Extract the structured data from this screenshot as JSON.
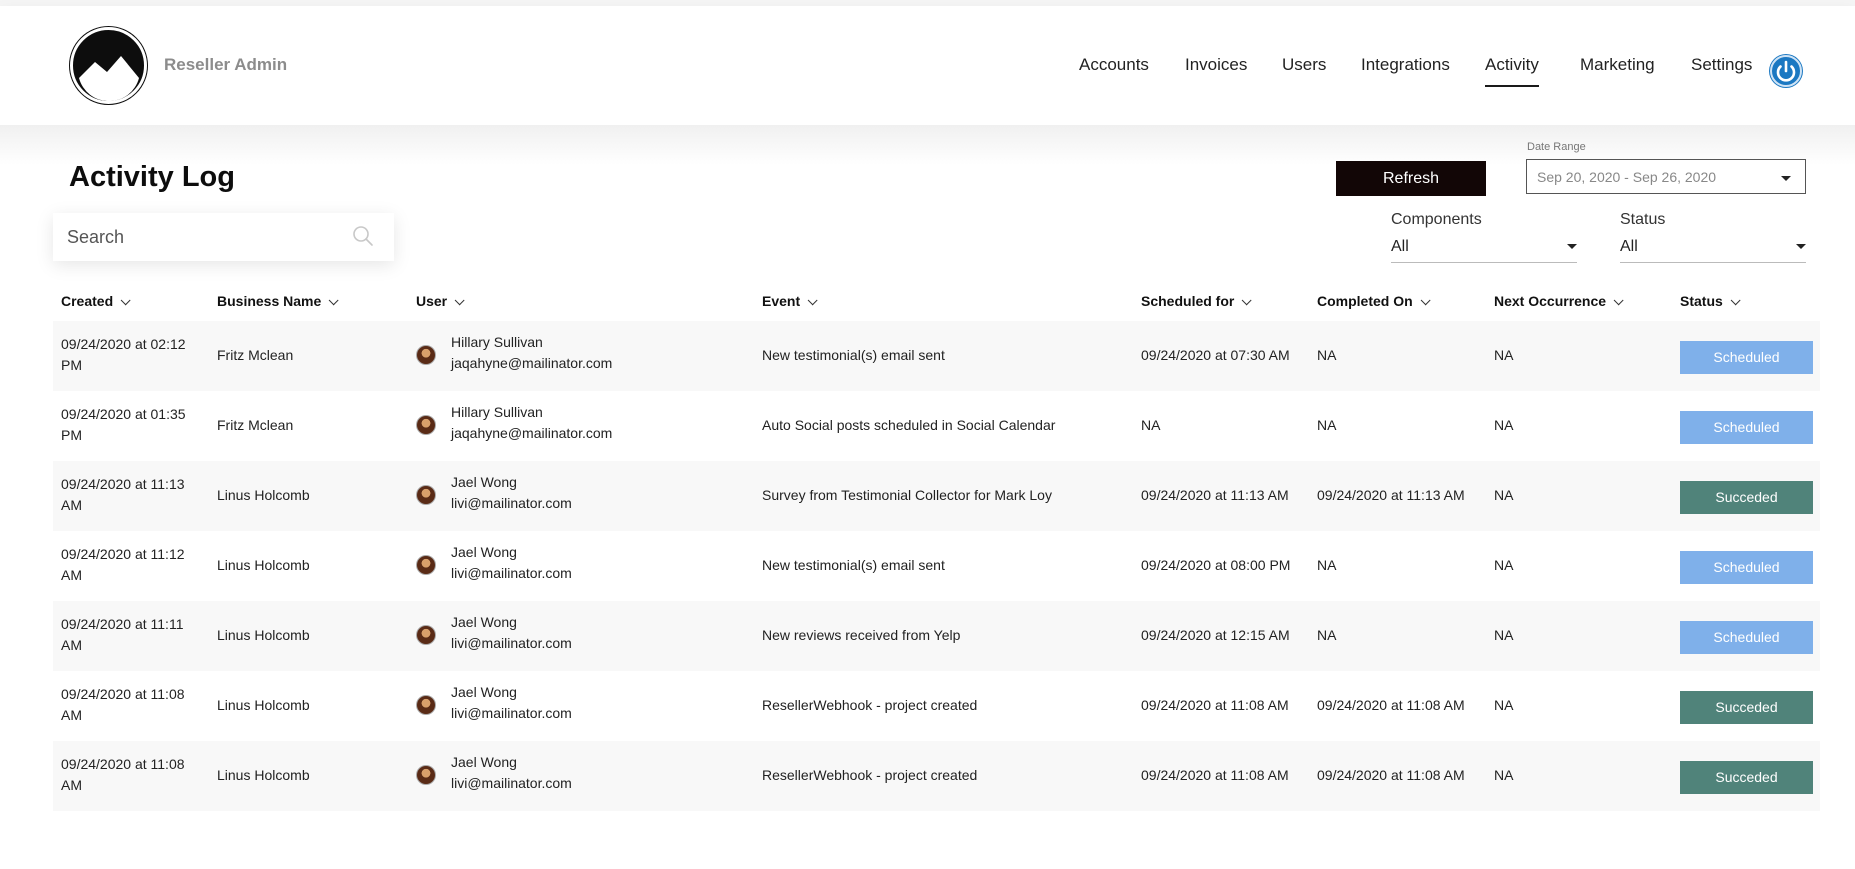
{
  "app": {
    "brand": "Reseller Admin"
  },
  "nav": {
    "items": [
      {
        "label": "Accounts"
      },
      {
        "label": "Invoices"
      },
      {
        "label": "Users"
      },
      {
        "label": "Integrations"
      },
      {
        "label": "Activity",
        "active": true
      },
      {
        "label": "Marketing"
      },
      {
        "label": "Settings"
      }
    ]
  },
  "page": {
    "title": "Activity Log",
    "refresh_label": "Refresh",
    "date_range_label": "Date Range",
    "date_range_value": "Sep 20, 2020 - Sep 26, 2020"
  },
  "search": {
    "placeholder": "Search"
  },
  "filters": {
    "components": {
      "label": "Components",
      "value": "All"
    },
    "status": {
      "label": "Status",
      "value": "All"
    }
  },
  "table": {
    "headers": {
      "created": "Created",
      "business": "Business Name",
      "user": "User",
      "event": "Event",
      "scheduled": "Scheduled for",
      "completed": "Completed On",
      "next": "Next Occurrence",
      "status": "Status"
    },
    "rows": [
      {
        "created": "09/24/2020 at 02:12 PM",
        "business": "Fritz Mclean",
        "user_name": "Hillary Sullivan",
        "user_email": "jaqahyne@mailinator.com",
        "event": "New testimonial(s) email sent",
        "scheduled": "09/24/2020 at 07:30 AM",
        "completed": "NA",
        "next": "NA",
        "status": "Scheduled"
      },
      {
        "created": "09/24/2020 at 01:35 PM",
        "business": "Fritz Mclean",
        "user_name": "Hillary Sullivan",
        "user_email": "jaqahyne@mailinator.com",
        "event": "Auto Social posts scheduled in Social Calendar",
        "scheduled": "NA",
        "completed": "NA",
        "next": "NA",
        "status": "Scheduled"
      },
      {
        "created": "09/24/2020 at 11:13 AM",
        "business": "Linus Holcomb",
        "user_name": "Jael Wong",
        "user_email": "livi@mailinator.com",
        "event": "Survey from Testimonial Collector for Mark Loy",
        "scheduled": "09/24/2020 at 11:13 AM",
        "completed": "09/24/2020 at 11:13 AM",
        "next": "NA",
        "status": "Succeded"
      },
      {
        "created": "09/24/2020 at 11:12 AM",
        "business": "Linus Holcomb",
        "user_name": "Jael Wong",
        "user_email": "livi@mailinator.com",
        "event": "New testimonial(s) email sent",
        "scheduled": "09/24/2020 at 08:00 PM",
        "completed": "NA",
        "next": "NA",
        "status": "Scheduled"
      },
      {
        "created": "09/24/2020 at 11:11 AM",
        "business": "Linus Holcomb",
        "user_name": "Jael Wong",
        "user_email": "livi@mailinator.com",
        "event": "New reviews received from Yelp",
        "scheduled": "09/24/2020 at 12:15 AM",
        "completed": "NA",
        "next": "NA",
        "status": "Scheduled"
      },
      {
        "created": "09/24/2020 at 11:08 AM",
        "business": "Linus Holcomb",
        "user_name": "Jael Wong",
        "user_email": "livi@mailinator.com",
        "event": "ResellerWebhook - project created",
        "scheduled": "09/24/2020 at 11:08 AM",
        "completed": "09/24/2020 at 11:08 AM",
        "next": "NA",
        "status": "Succeded"
      },
      {
        "created": "09/24/2020 at 11:08 AM",
        "business": "Linus Holcomb",
        "user_name": "Jael Wong",
        "user_email": "livi@mailinator.com",
        "event": "ResellerWebhook - project created",
        "scheduled": "09/24/2020 at 11:08 AM",
        "completed": "09/24/2020 at 11:08 AM",
        "next": "NA",
        "status": "Succeded"
      }
    ]
  },
  "colors": {
    "scheduled": "#7fb0ea",
    "succeded": "#50837a",
    "power_button": "#1b78c2",
    "refresh_button": "#120606"
  },
  "icons": {
    "logo": "mountain-logo-icon",
    "power": "power-icon",
    "search": "search-icon",
    "dropdown": "caret-down-icon",
    "sort": "chevron-down-icon",
    "avatar": "user-avatar"
  }
}
